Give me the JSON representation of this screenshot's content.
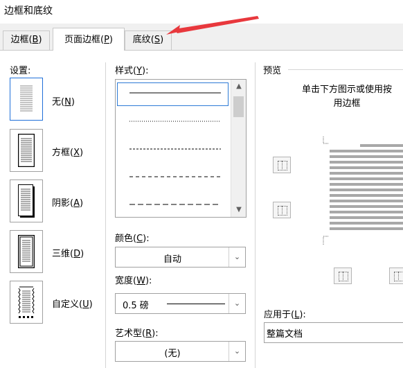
{
  "window": {
    "title": "边框和底纹"
  },
  "tabs": [
    {
      "label": "边框(B)",
      "prefix": "边框(",
      "key": "B",
      "suffix": ")"
    },
    {
      "label": "页面边框(P)",
      "prefix": "页面边框(",
      "key": "P",
      "suffix": ")"
    },
    {
      "label": "底纹(S)",
      "prefix": "底纹(",
      "key": "S",
      "suffix": ")"
    }
  ],
  "settings": {
    "title": "设置:",
    "items": [
      {
        "prefix": "无(",
        "key": "N",
        "suffix": ")"
      },
      {
        "prefix": "方框(",
        "key": "X",
        "suffix": ")"
      },
      {
        "prefix": "阴影(",
        "key": "A",
        "suffix": ")"
      },
      {
        "prefix": "三维(",
        "key": "D",
        "suffix": ")"
      },
      {
        "prefix": "自定义(",
        "key": "U",
        "suffix": ")"
      }
    ]
  },
  "style": {
    "prefix": "样式(",
    "key": "Y",
    "suffix": "):"
  },
  "color": {
    "prefix": "颜色(",
    "key": "C",
    "suffix": "):",
    "value": "自动"
  },
  "width": {
    "prefix": "宽度(",
    "key": "W",
    "suffix": "):",
    "value": "0.5 磅"
  },
  "art": {
    "prefix": "艺术型(",
    "key": "R",
    "suffix": "):",
    "value": "(无)"
  },
  "preview": {
    "title": "预览",
    "hint_line1": "单击下方图示或使用按",
    "hint_line2": "用边框"
  },
  "apply": {
    "prefix": "应用于(",
    "key": "L",
    "suffix": "):",
    "value": "整篇文档"
  },
  "colors": {
    "accent": "#1e6fd9",
    "annotation": "#e8383d"
  }
}
